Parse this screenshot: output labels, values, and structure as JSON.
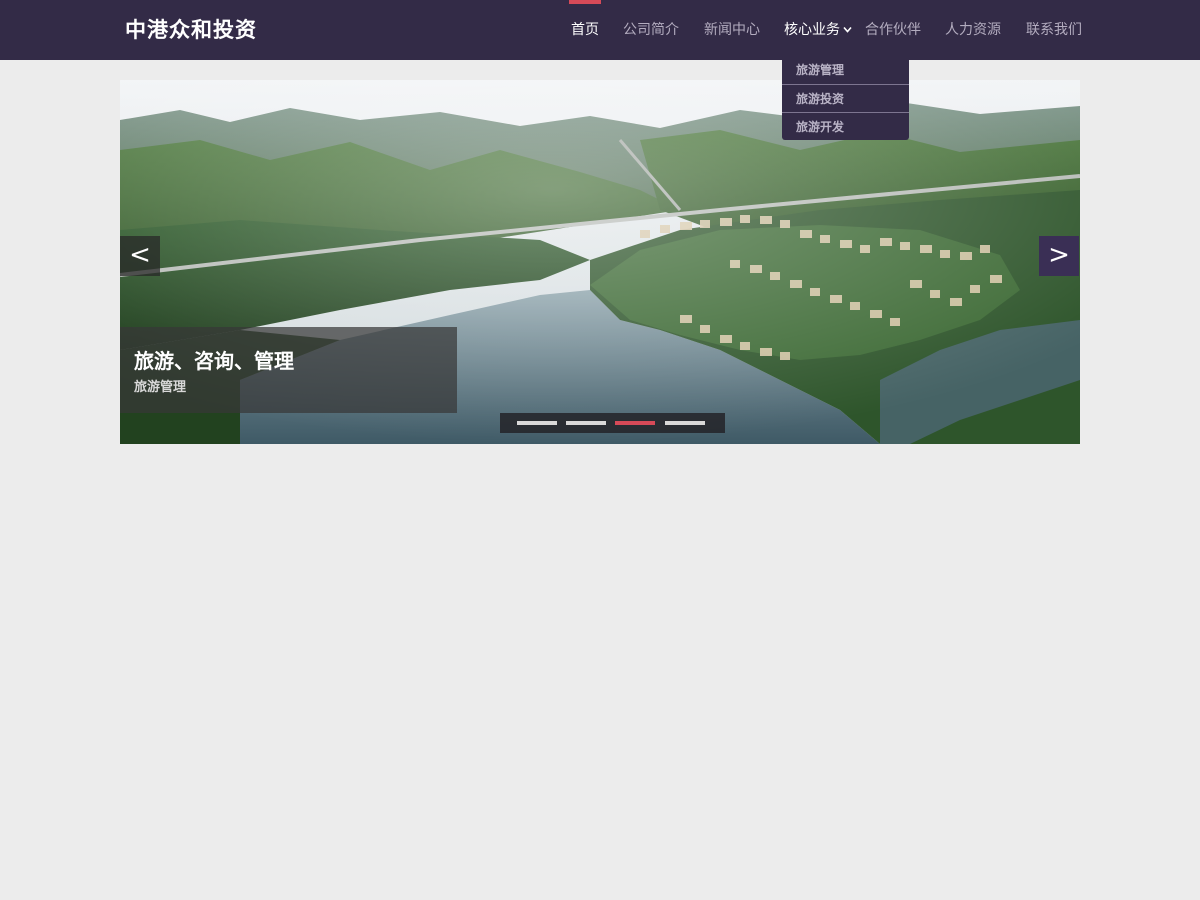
{
  "brand": {
    "name": "中港众和投资"
  },
  "nav": {
    "items": [
      {
        "label": "首页"
      },
      {
        "label": "公司简介"
      },
      {
        "label": "新闻中心"
      },
      {
        "label": "核心业务"
      },
      {
        "label": "合作伙伴"
      },
      {
        "label": "人力资源"
      },
      {
        "label": "联系我们"
      }
    ],
    "active_index": 0,
    "open_index": 3
  },
  "dropdown": {
    "items": [
      {
        "label": "旅游管理"
      },
      {
        "label": "旅游投资"
      },
      {
        "label": "旅游开发"
      }
    ]
  },
  "slider": {
    "caption_title": "旅游、咨询、管理",
    "caption_subtitle": "旅游管理",
    "prev_label": "<",
    "next_label": ">",
    "slide_count": 4,
    "active_slide_index": 2
  },
  "colors": {
    "header_bg": "#332b47",
    "accent": "#d64a58",
    "page_bg": "#ececec"
  },
  "icons": {
    "dropdown_indicator": "chevron-down-icon",
    "prev": "chevron-left-icon",
    "next": "chevron-right-icon"
  }
}
